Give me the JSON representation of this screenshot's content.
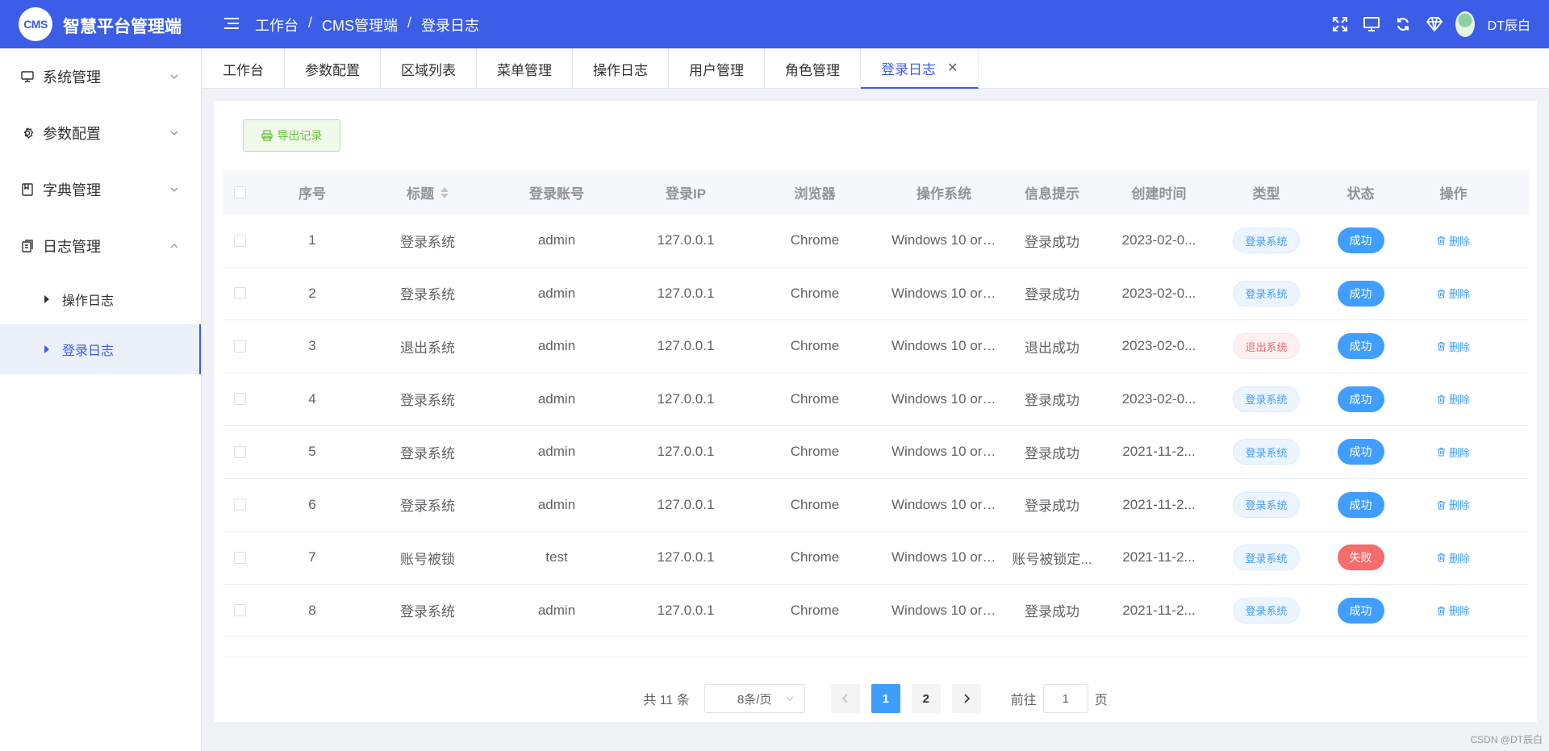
{
  "app": {
    "logo_text": "CMS",
    "title": "智慧平台管理端"
  },
  "breadcrumb": [
    "工作台",
    "CMS管理端",
    "登录日志"
  ],
  "header": {
    "user_name": "DT辰白",
    "icons": [
      "fullscreen-icon",
      "monitor-icon",
      "refresh-icon",
      "diamond-icon",
      "avatar"
    ]
  },
  "sidebar": {
    "menus": [
      {
        "label": "系统管理",
        "icon": "monitor-icon",
        "expanded": false
      },
      {
        "label": "参数配置",
        "icon": "gear-icon",
        "expanded": false
      },
      {
        "label": "字典管理",
        "icon": "dictionary-icon",
        "expanded": false
      },
      {
        "label": "日志管理",
        "icon": "log-icon",
        "expanded": true
      }
    ],
    "submenus": [
      {
        "label": "操作日志",
        "active": false
      },
      {
        "label": "登录日志",
        "active": true
      }
    ]
  },
  "tabs": [
    {
      "label": "工作台",
      "active": false
    },
    {
      "label": "参数配置",
      "active": false
    },
    {
      "label": "区域列表",
      "active": false
    },
    {
      "label": "菜单管理",
      "active": false
    },
    {
      "label": "操作日志",
      "active": false
    },
    {
      "label": "用户管理",
      "active": false
    },
    {
      "label": "角色管理",
      "active": false
    },
    {
      "label": "登录日志",
      "active": true,
      "closable": true
    }
  ],
  "toolbar": {
    "export_label": "导出记录"
  },
  "table": {
    "headers": {
      "index": "序号",
      "title": "标题",
      "account": "登录账号",
      "ip": "登录IP",
      "browser": "浏览器",
      "os": "操作系统",
      "info": "信息提示",
      "time": "创建时间",
      "type": "类型",
      "status": "状态",
      "op": "操作"
    },
    "rows": [
      {
        "index": "1",
        "title": "登录系统",
        "account": "admin",
        "ip": "127.0.0.1",
        "browser": "Chrome",
        "os": "Windows 10 or Wi...",
        "info": "登录成功",
        "time": "2023-02-0...",
        "type": "登录系统",
        "type_kind": "primary",
        "status": "成功",
        "status_kind": "success",
        "op": "删除"
      },
      {
        "index": "2",
        "title": "登录系统",
        "account": "admin",
        "ip": "127.0.0.1",
        "browser": "Chrome",
        "os": "Windows 10 or Wi...",
        "info": "登录成功",
        "time": "2023-02-0...",
        "type": "登录系统",
        "type_kind": "primary",
        "status": "成功",
        "status_kind": "success",
        "op": "删除"
      },
      {
        "index": "3",
        "title": "退出系统",
        "account": "admin",
        "ip": "127.0.0.1",
        "browser": "Chrome",
        "os": "Windows 10 or Wi...",
        "info": "退出成功",
        "time": "2023-02-0...",
        "type": "退出系统",
        "type_kind": "danger",
        "status": "成功",
        "status_kind": "success",
        "op": "删除"
      },
      {
        "index": "4",
        "title": "登录系统",
        "account": "admin",
        "ip": "127.0.0.1",
        "browser": "Chrome",
        "os": "Windows 10 or Wi...",
        "info": "登录成功",
        "time": "2023-02-0...",
        "type": "登录系统",
        "type_kind": "primary",
        "status": "成功",
        "status_kind": "success",
        "op": "删除"
      },
      {
        "index": "5",
        "title": "登录系统",
        "account": "admin",
        "ip": "127.0.0.1",
        "browser": "Chrome",
        "os": "Windows 10 or Wi...",
        "info": "登录成功",
        "time": "2021-11-2...",
        "type": "登录系统",
        "type_kind": "primary",
        "status": "成功",
        "status_kind": "success",
        "op": "删除"
      },
      {
        "index": "6",
        "title": "登录系统",
        "account": "admin",
        "ip": "127.0.0.1",
        "browser": "Chrome",
        "os": "Windows 10 or Wi...",
        "info": "登录成功",
        "time": "2021-11-2...",
        "type": "登录系统",
        "type_kind": "primary",
        "status": "成功",
        "status_kind": "success",
        "op": "删除"
      },
      {
        "index": "7",
        "title": "账号被锁",
        "account": "test",
        "ip": "127.0.0.1",
        "browser": "Chrome",
        "os": "Windows 10 or Wi...",
        "info": "账号被锁定...",
        "time": "2021-11-2...",
        "type": "登录系统",
        "type_kind": "primary",
        "status": "失败",
        "status_kind": "fail",
        "op": "删除"
      },
      {
        "index": "8",
        "title": "登录系统",
        "account": "admin",
        "ip": "127.0.0.1",
        "browser": "Chrome",
        "os": "Windows 10 or Wi...",
        "info": "登录成功",
        "time": "2021-11-2...",
        "type": "登录系统",
        "type_kind": "primary",
        "status": "成功",
        "status_kind": "success",
        "op": "删除"
      }
    ]
  },
  "pagination": {
    "total": "共 11 条",
    "page_size": "8条/页",
    "pages": [
      "1",
      "2"
    ],
    "current": "1",
    "goto_label": "前往",
    "goto_value": "1",
    "page_unit": "页"
  },
  "watermark": "CSDN @DT辰白",
  "colors": {
    "primary": "#3b5de7",
    "success_btn": "#409eff",
    "danger": "#f56c6c",
    "export_green": "#67c23a"
  }
}
